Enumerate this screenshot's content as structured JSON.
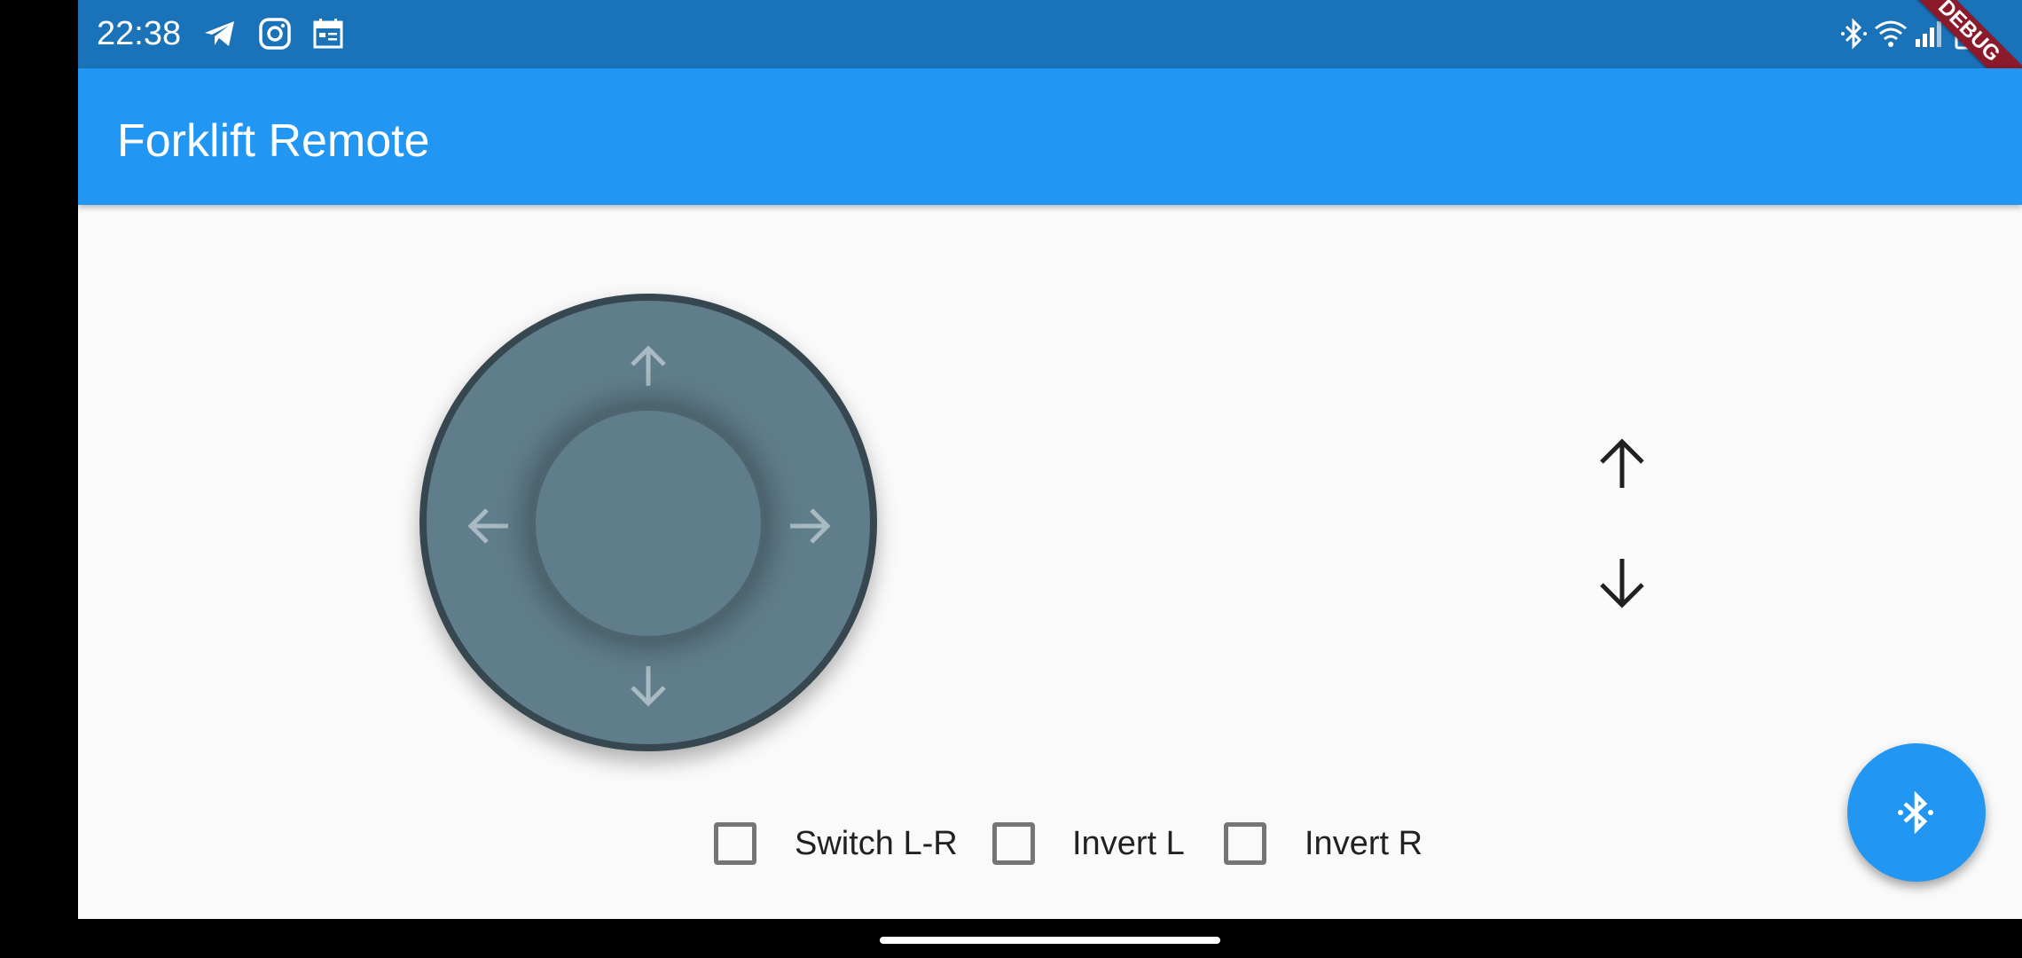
{
  "status_bar": {
    "time": "22:38",
    "left_icons": [
      "telegram-icon",
      "instagram-icon",
      "calendar-icon"
    ],
    "right_icons": [
      "bluetooth-icon",
      "wifi-icon",
      "signal-icon",
      "battery-charging-icon"
    ]
  },
  "app_bar": {
    "title": "Forklift Remote",
    "color": "#2196f3"
  },
  "debug_banner": {
    "label": "DEBUG"
  },
  "joystick": {
    "arrows": [
      "up-arrow-icon",
      "down-arrow-icon",
      "left-arrow-icon",
      "right-arrow-icon"
    ],
    "color": "#607d8b"
  },
  "lift_controls": {
    "up_icon": "arrow-up-icon",
    "down_icon": "arrow-down-icon"
  },
  "options": [
    {
      "label": "Switch L-R",
      "checked": false
    },
    {
      "label": "Invert L",
      "checked": false
    },
    {
      "label": "Invert R",
      "checked": false
    }
  ],
  "fab": {
    "icon": "bluetooth-searching-icon",
    "color": "#2196f3"
  }
}
